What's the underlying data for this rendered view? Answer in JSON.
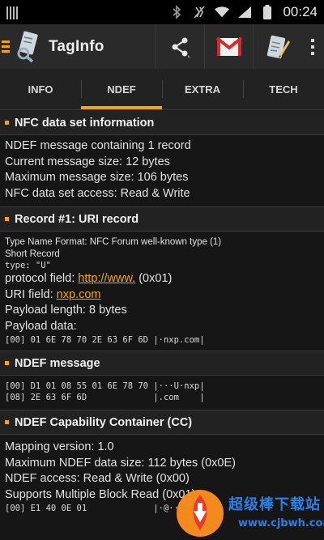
{
  "status_bar": {
    "time": "00:24"
  },
  "app": {
    "title": "TagInfo"
  },
  "tabs": [
    {
      "label": "INFO"
    },
    {
      "label": "NDEF"
    },
    {
      "label": "EXTRA"
    },
    {
      "label": "TECH"
    }
  ],
  "active_tab": "NDEF",
  "colors": {
    "accent": "#f3a316",
    "background": "#161616",
    "header": "#2a2a2a"
  },
  "sections": {
    "nfc": {
      "title": "NFC data set information",
      "lines": [
        "NDEF message containing 1 record",
        "Current message size: 12 bytes",
        "Maximum message size: 106 bytes",
        "NFC data set access: Read & Write"
      ]
    },
    "record": {
      "title": "Record #1: URI record",
      "tnf": "Type Name Format: NFC Forum well-known type (1)",
      "short": "Short Record",
      "type": "type: \"U\"",
      "protocol_label": "protocol field: ",
      "protocol_link": "http://www.",
      "protocol_code": " (0x01)",
      "uri_label": "URI field: ",
      "uri_link": "nxp.com",
      "payload_length": "Payload length: 8 bytes",
      "payload_data_label": "Payload data:",
      "payload_hex": "[00] 01 6E 78 70 2E 63 6F 6D |·nxp.com|"
    },
    "ndef_message": {
      "title": "NDEF message",
      "hex_lines": [
        "[00] D1 01 08 55 01 6E 78 70 |···U·nxp|",
        "[08] 2E 63 6F 6D             |.com    |"
      ]
    },
    "cc": {
      "title": "NDEF Capability Container (CC)",
      "lines": [
        "Mapping version: 1.0",
        "Maximum NDEF data size: 112 bytes (0x0E)",
        "NDEF access: Read & Write (0x00)",
        "Supports Multiple Block Read (0x01)"
      ],
      "hex": "[00] E1 40 0E 01             |·@··|"
    }
  },
  "watermark": {
    "text1": "超级棒下载站",
    "text2": "www.cjbwh.com"
  }
}
